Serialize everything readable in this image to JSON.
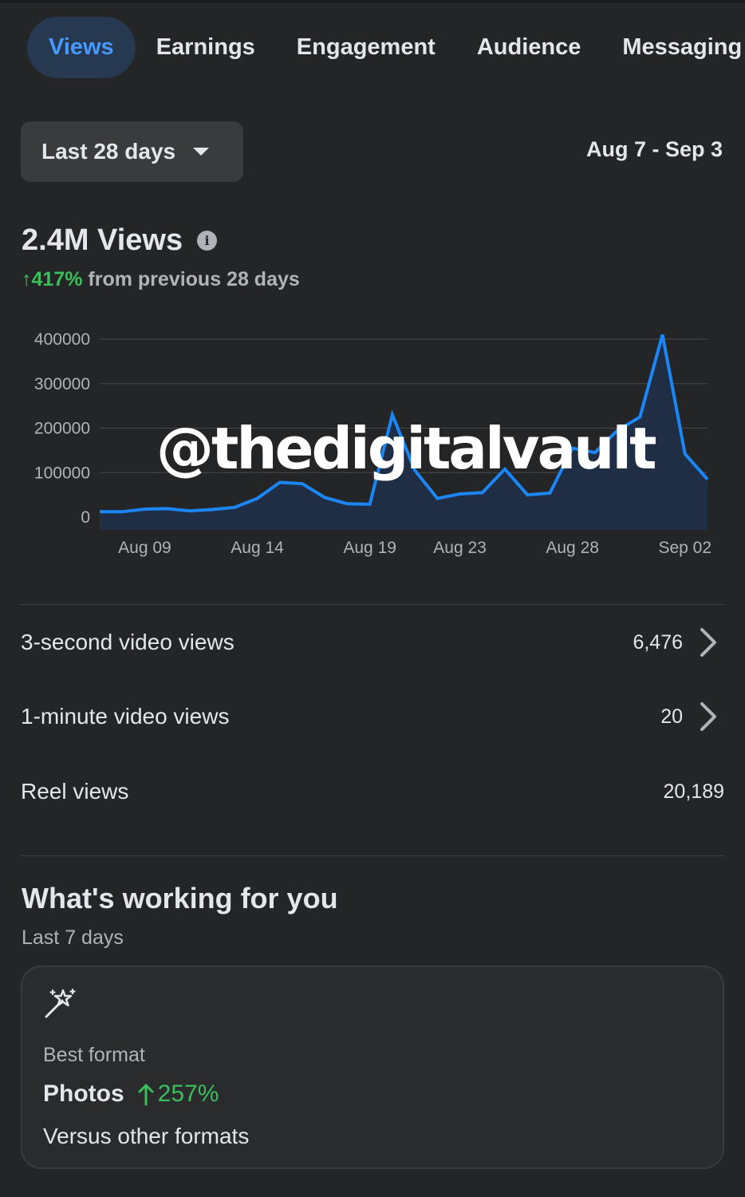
{
  "tabs": [
    "Views",
    "Earnings",
    "Engagement",
    "Audience",
    "Messaging"
  ],
  "active_tab": "Views",
  "range_selector": {
    "label": "Last 28 days"
  },
  "date_range": "Aug 7 - Sep 3",
  "summary": {
    "title": "2.4M Views",
    "change_arrow": "↑",
    "change_pct": "417%",
    "change_text": "from previous 28 days"
  },
  "watermark": "@thedigitalvault",
  "chart_data": {
    "type": "area",
    "x": [
      "Aug 07",
      "Aug 08",
      "Aug 09",
      "Aug 10",
      "Aug 11",
      "Aug 12",
      "Aug 13",
      "Aug 14",
      "Aug 15",
      "Aug 16",
      "Aug 17",
      "Aug 18",
      "Aug 19",
      "Aug 20",
      "Aug 21",
      "Aug 22",
      "Aug 23",
      "Aug 24",
      "Aug 25",
      "Aug 26",
      "Aug 27",
      "Aug 28",
      "Aug 29",
      "Aug 30",
      "Aug 31",
      "Sep 01",
      "Sep 02",
      "Sep 03"
    ],
    "values": [
      12000,
      12000,
      18000,
      19000,
      14000,
      17000,
      22000,
      42000,
      78000,
      75000,
      44000,
      30000,
      29000,
      230000,
      105000,
      42000,
      52000,
      55000,
      108000,
      50000,
      54000,
      155000,
      145000,
      195000,
      225000,
      410000,
      142000,
      85000
    ],
    "xticks": [
      "Aug 09",
      "Aug 14",
      "Aug 19",
      "Aug 23",
      "Aug 28",
      "Sep 02"
    ],
    "yticks": [
      "0",
      "100000",
      "200000",
      "300000",
      "400000"
    ],
    "ylim": [
      0,
      400000
    ],
    "grid": true,
    "line_color": "#1b86f5",
    "fill_color": "#1f2d45"
  },
  "metrics": [
    {
      "label": "3-second video views",
      "value": "6,476",
      "has_chevron": true
    },
    {
      "label": "1-minute video views",
      "value": "20",
      "has_chevron": true
    },
    {
      "label": "Reel views",
      "value": "20,189",
      "has_chevron": false
    }
  ],
  "working": {
    "title": "What's working for you",
    "subtitle": "Last 7 days",
    "card": {
      "icon": "magic-wand-icon",
      "label": "Best format",
      "format": "Photos",
      "change_pct": "257%",
      "caption": "Versus other formats"
    }
  },
  "colors": {
    "background": "#242527",
    "accent": "#4599ff",
    "positive": "#3bbf5a",
    "muted_text": "#b0b3b8"
  }
}
